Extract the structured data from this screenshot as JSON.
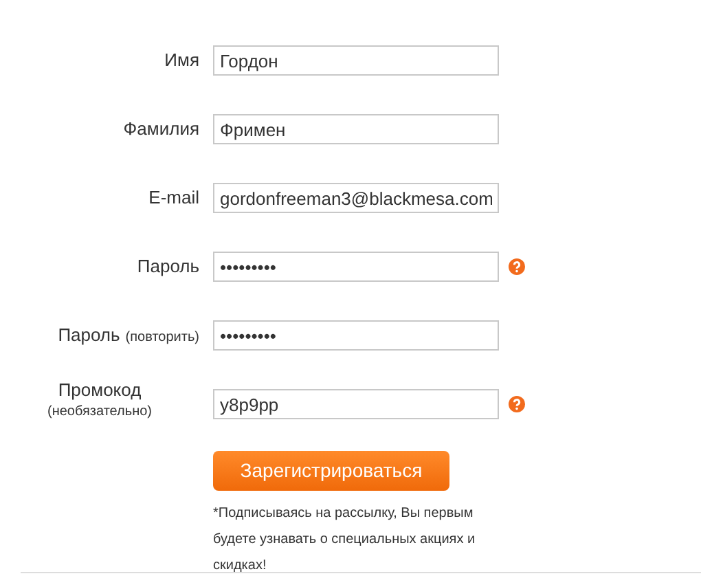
{
  "fields": [
    {
      "kind": "plain",
      "label": "Имя",
      "value": "Гордон",
      "help": false
    },
    {
      "kind": "plain",
      "label": "Фамилия",
      "value": "Фримен",
      "help": false
    },
    {
      "kind": "plain",
      "label": "E-mail",
      "value": "gordonfreeman3@blackmesa.com",
      "help": false
    },
    {
      "kind": "plain",
      "label": "Пароль",
      "value": "•••••••••",
      "help": true
    },
    {
      "kind": "inline-note",
      "label": "Пароль",
      "note": "(повторить)",
      "value": "•••••••••",
      "help": false
    },
    {
      "kind": "stacked-note",
      "label": "Промокод",
      "note": "(необязательно)",
      "value": "y8p9pp",
      "help": true
    }
  ],
  "submit": {
    "label": "Зарегистрироваться"
  },
  "disclaimer": "*Подписываясь на рассылку, Вы первым будете узнавать о специальных акциях и скидках!"
}
